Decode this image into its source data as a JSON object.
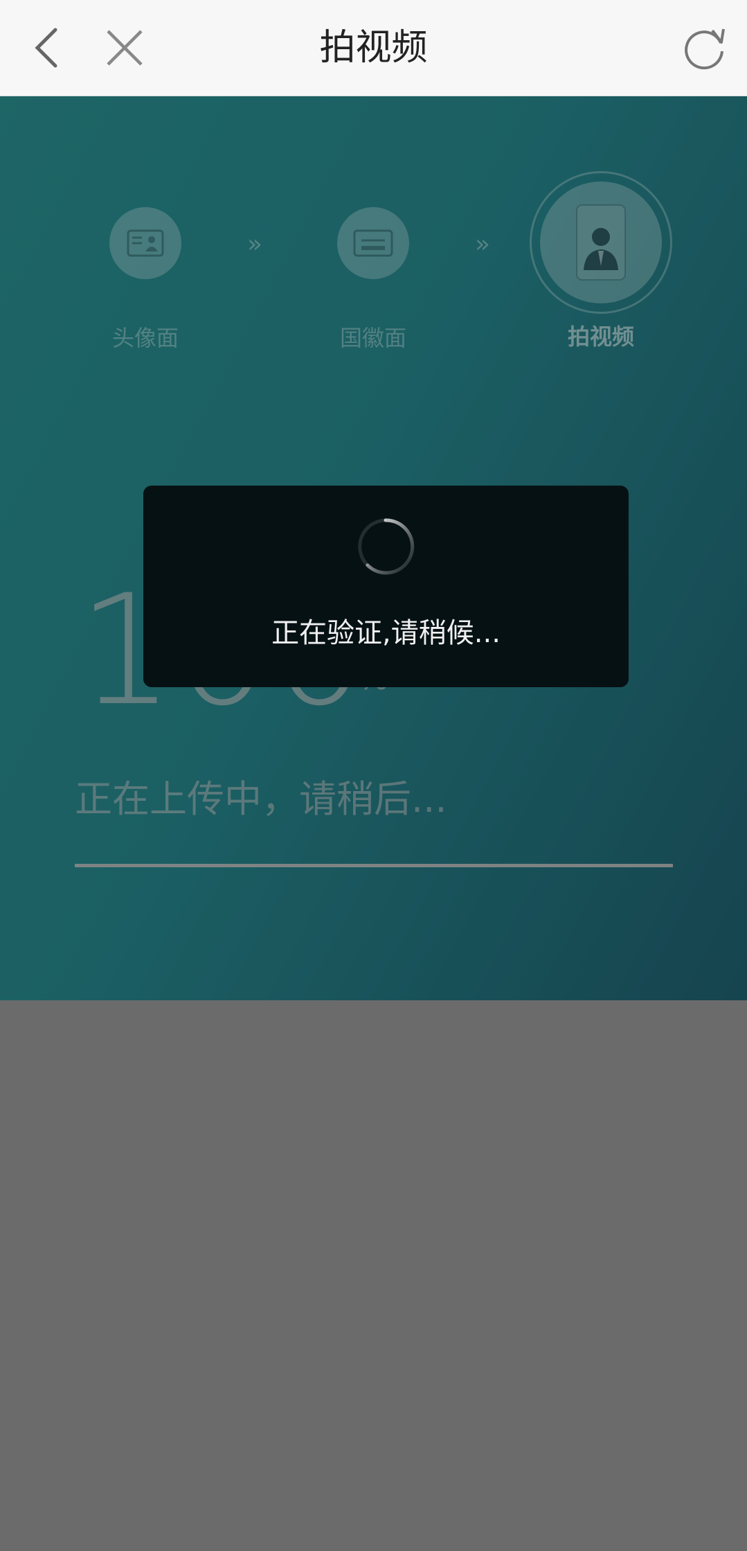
{
  "navbar": {
    "title": "拍视频",
    "back_icon": "chevron-left-icon",
    "close_icon": "close-icon",
    "refresh_icon": "refresh-icon"
  },
  "steps": [
    {
      "label": "头像面",
      "icon": "id-card-portrait-icon",
      "state": "done"
    },
    {
      "label": "国徽面",
      "icon": "id-card-emblem-icon",
      "state": "done"
    },
    {
      "label": "拍视频",
      "icon": "video-portrait-icon",
      "state": "active"
    }
  ],
  "step_separator": "»",
  "upload": {
    "percent": "100",
    "percent_unit": "%",
    "status_text": "正在上传中，请稍后...",
    "progress": 1.0
  },
  "dialog": {
    "text": "正在验证,请稍候..."
  },
  "colors": {
    "navbar_bg": "#f7f7f7",
    "panel_teal": "#26848a",
    "overlay_gray": "#6b6b6b",
    "dialog_bg": "#061114"
  }
}
